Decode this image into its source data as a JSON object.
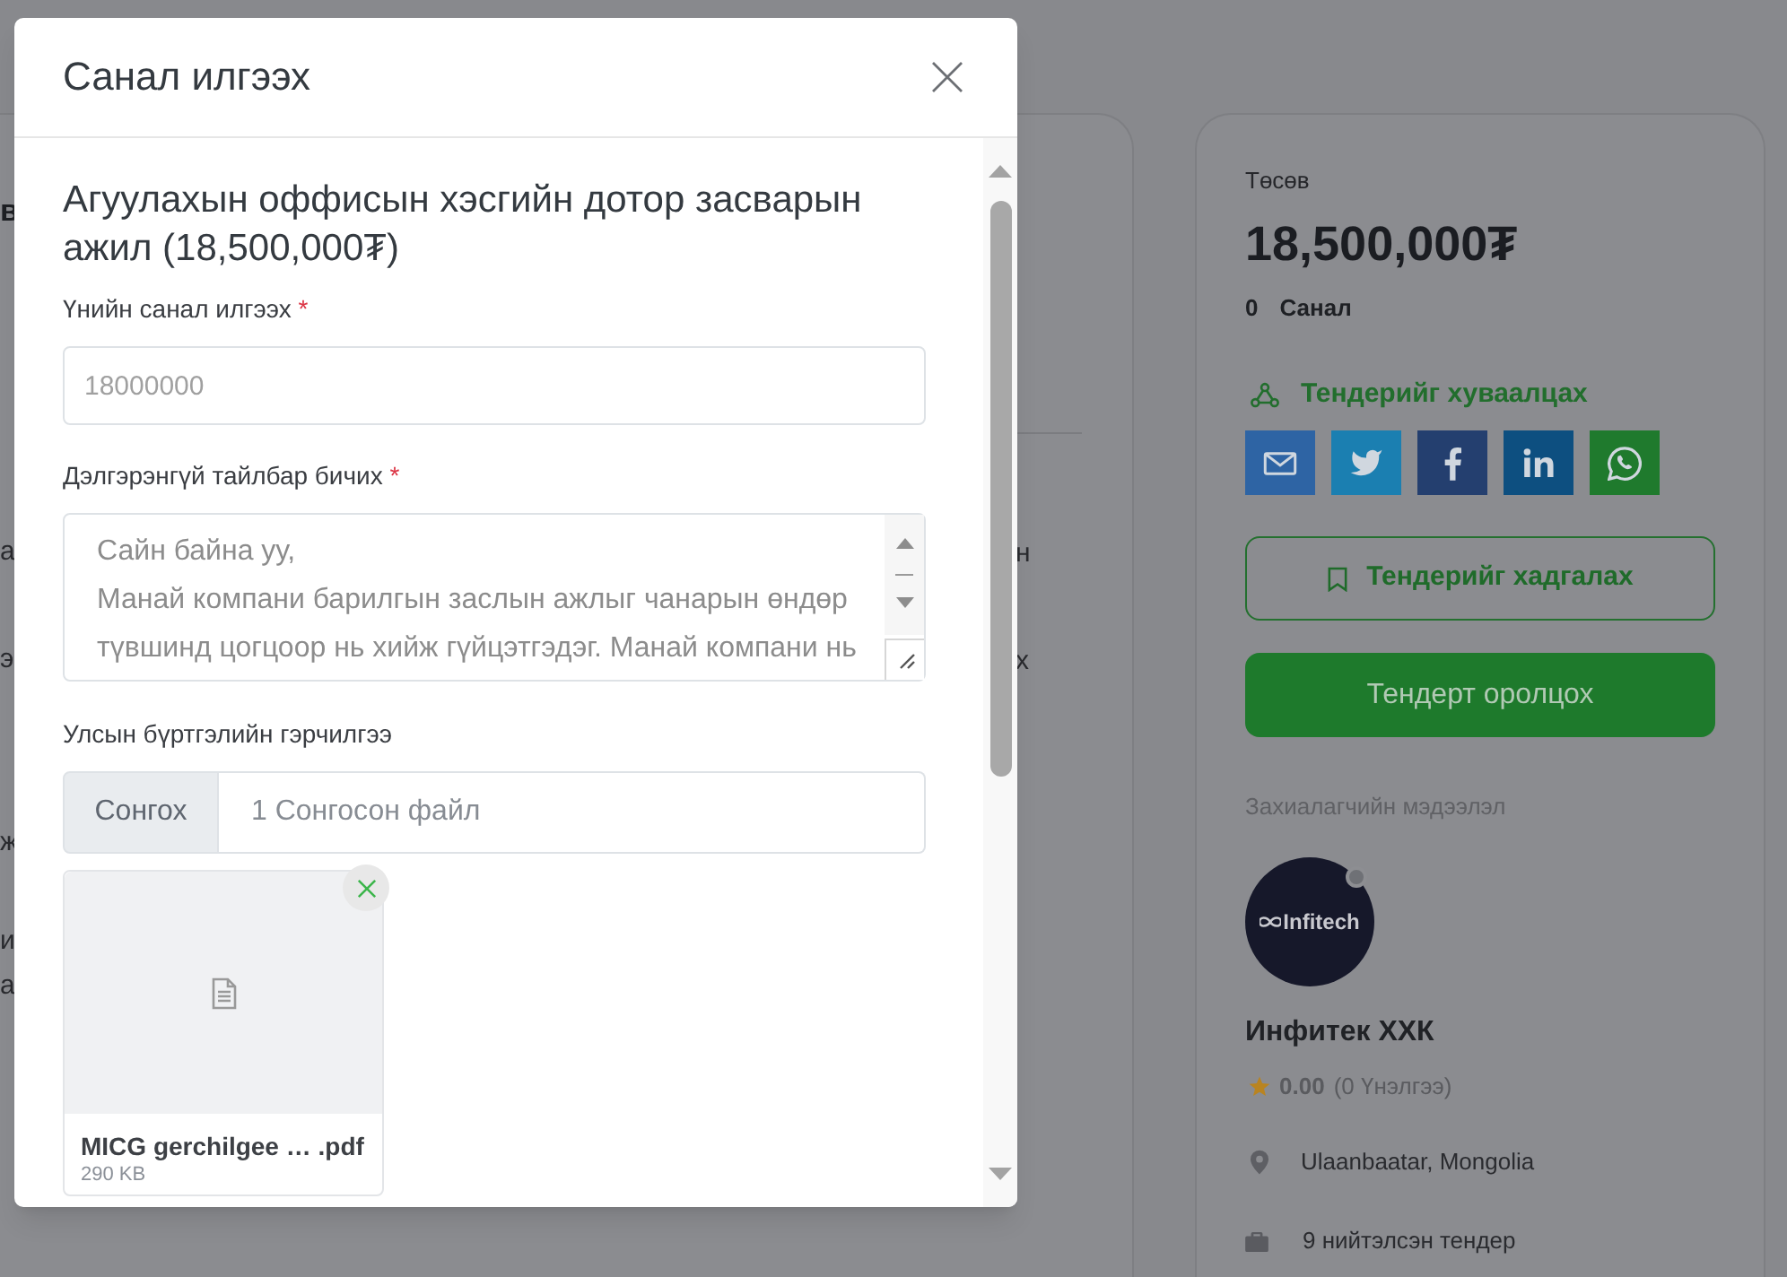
{
  "left_card": {
    "left_edge_text": [
      {
        "text": "в",
        "kind": "heading"
      },
      {
        "text": "а",
        "kind": "body"
      },
      {
        "text": "э",
        "kind": "body"
      },
      {
        "text": "ж",
        "kind": "body"
      },
      {
        "text": "и",
        "kind": "body"
      },
      {
        "text": "а",
        "kind": "body"
      }
    ],
    "right_edge_text": [
      "н",
      "х"
    ]
  },
  "tender_card": {
    "budget_label": "Төсөв",
    "budget": "18,500,000₮",
    "offer_count": "0",
    "offer_label": "Санал",
    "share_label": "Тендерийг хуваалцах",
    "share_buttons": [
      {
        "kind": "email"
      },
      {
        "kind": "twitter"
      },
      {
        "kind": "facebook"
      },
      {
        "kind": "linkedin"
      },
      {
        "kind": "whatsapp"
      }
    ],
    "save_button": "Тендерийг хадгалах",
    "participate_button": "Тендерт оролцох",
    "client_label": "Захиалагчийн мэдээлэл",
    "client": {
      "logo_text": "Infitech",
      "online": false,
      "name": "Инфитек ХХК",
      "rating": "0.00",
      "reviews": "(0 Үнэлгээ)",
      "location": "Ulaanbaatar, Mongolia",
      "tenders": "9 нийтэлсэн тендер"
    }
  },
  "modal": {
    "title": "Санал илгээх",
    "heading": "Агуулахын оффисын хэсгийн дотор засварын ажил (18,500,000₮)",
    "fields": [
      {
        "kind": "text",
        "label": "Үнийн санал илгээх",
        "required_mark": "*",
        "placeholder": "18000000"
      },
      {
        "kind": "textarea",
        "label": "Дэлгэрэнгүй тайлбар бичих",
        "required_mark": "*",
        "placeholder": "Сайн байна уу,\nМанай компани барилгын заслын ажлыг чанарын өндөр түвшинд цогцоор нь хийж гүйцэтгэдэг. Манай компани нь"
      },
      {
        "kind": "file",
        "label": "Улсын бүртгэлийн гэрчилгээ",
        "button": "Сонгох",
        "value": "1 Сонгосон файл",
        "files": [
          {
            "name": "MICG gerchilgee … .pdf",
            "size": "290 KB"
          }
        ]
      }
    ]
  }
}
